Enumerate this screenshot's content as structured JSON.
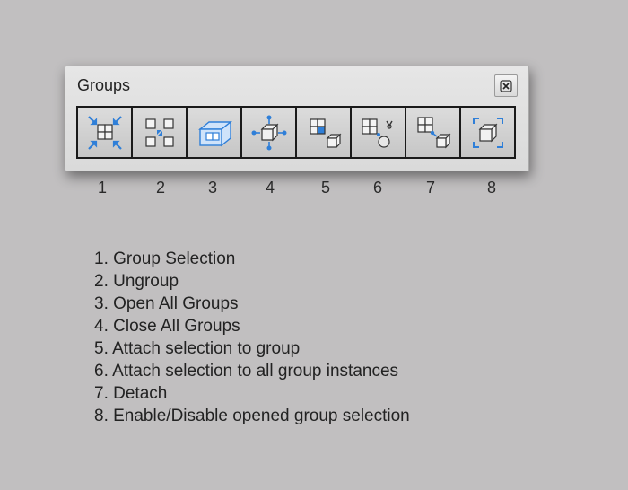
{
  "panel": {
    "title": "Groups",
    "close_label": "close"
  },
  "toolbar": {
    "buttons": [
      {
        "number": "1",
        "icon": "group-selection-icon"
      },
      {
        "number": "2",
        "icon": "ungroup-icon"
      },
      {
        "number": "3",
        "icon": "open-all-groups-icon"
      },
      {
        "number": "4",
        "icon": "close-all-groups-icon"
      },
      {
        "number": "5",
        "icon": "attach-selection-to-group-icon"
      },
      {
        "number": "6",
        "icon": "attach-to-all-instances-icon"
      },
      {
        "number": "7",
        "icon": "detach-icon"
      },
      {
        "number": "8",
        "icon": "enable-disable-opened-group-selection-icon"
      }
    ]
  },
  "legend": [
    "1.  Group Selection",
    "2.  Ungroup",
    "3.  Open All Groups",
    "4.  Close All Groups",
    "5.  Attach selection to group",
    "6. Attach selection to all group instances",
    "7. Detach",
    "8. Enable/Disable opened group selection"
  ],
  "colors": {
    "background": "#c1bfc0",
    "accent_blue": "#2f7fd8",
    "toolbar_border": "#1a1a1a"
  }
}
